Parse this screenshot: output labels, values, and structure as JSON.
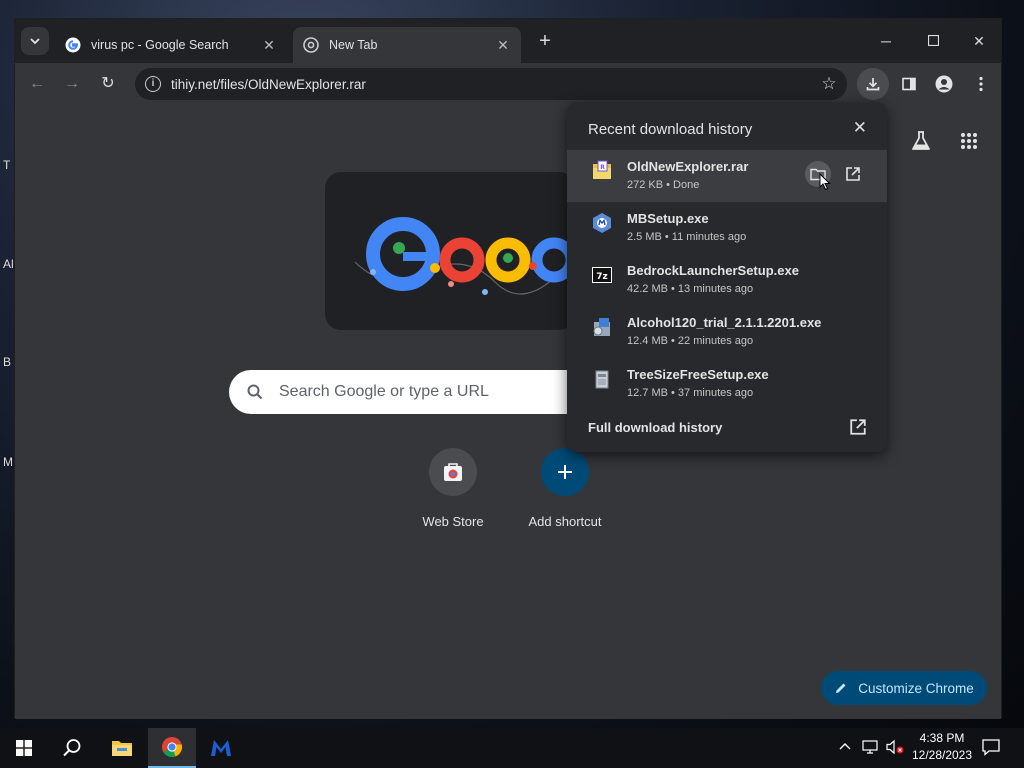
{
  "desktop": {
    "labels": [
      "T",
      "Al",
      "B",
      "M"
    ]
  },
  "tabs": [
    {
      "title": "virus pc - Google Search",
      "favicon": "google-g-icon",
      "active": false
    },
    {
      "title": "New Tab",
      "favicon": "chrome-icon",
      "active": true
    }
  ],
  "toolbar": {
    "url": "tihiy.net/files/OldNewExplorer.rar"
  },
  "newtab": {
    "search_placeholder": "Search Google or type a URL",
    "shortcuts": [
      {
        "label": "Web Store",
        "icon": "web-store-icon"
      },
      {
        "label": "Add shortcut",
        "icon": "plus-icon"
      }
    ],
    "customize_label": "Customize Chrome"
  },
  "downloads": {
    "title": "Recent download history",
    "items": [
      {
        "name": "OldNewExplorer.rar",
        "meta": "272 KB • Done",
        "icon": "rar-archive-icon"
      },
      {
        "name": "MBSetup.exe",
        "meta": "2.5 MB • 11 minutes ago",
        "icon": "malwarebytes-installer-icon"
      },
      {
        "name": "BedrockLauncherSetup.exe",
        "meta": "42.2 MB • 13 minutes ago",
        "icon": "7zip-icon"
      },
      {
        "name": "Alcohol120_trial_2.1.1.2201.exe",
        "meta": "12.4 MB • 22 minutes ago",
        "icon": "installer-icon"
      },
      {
        "name": "TreeSizeFreeSetup.exe",
        "meta": "12.7 MB • 37 minutes ago",
        "icon": "setup-icon"
      }
    ],
    "full_history_label": "Full download history"
  },
  "taskbar": {
    "time": "4:38 PM",
    "date": "12/28/2023"
  },
  "colors": {
    "accent": "#004a77",
    "accent_text": "#c2e7ff",
    "frame": "#202124",
    "toolbar": "#35363a"
  }
}
